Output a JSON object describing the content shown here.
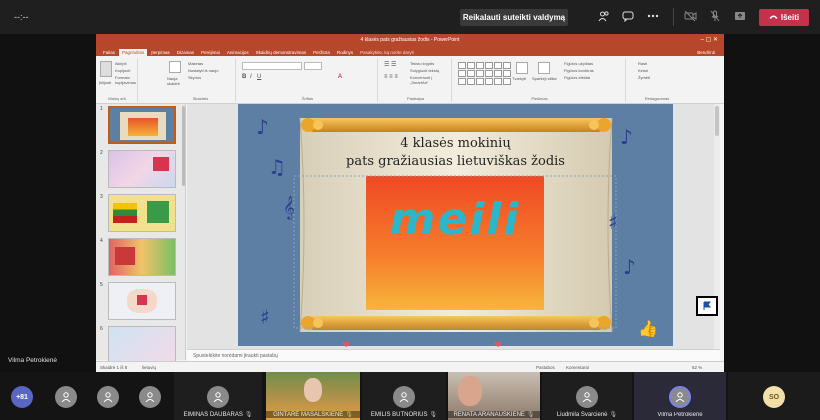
{
  "teams": {
    "timer": "--:--",
    "request_control_label": "Reikalauti suteikti valdymą",
    "leave_label": "Išeiti",
    "colors": {
      "leave": "#c4314b",
      "topbar": "#1f1f1f"
    }
  },
  "ppt": {
    "window_title": "4 klasės pats gražiausias žodis - PowerPoint",
    "tabs": [
      "Failas",
      "Pagrindinis",
      "Įterpimas",
      "Dizainas",
      "Perėjimai",
      "Animacijos",
      "Skaidrių demonstravimas",
      "Peržiūra",
      "Rodinys",
      "Pasakykite, ką norite daryti"
    ],
    "share_label": "Bendrinti",
    "ribbon": {
      "clipboard": {
        "label": "Mainų srit.",
        "items": [
          "Įklijuoti",
          "Iškirpti",
          "Kopijuoti",
          "Formato kopijavimas"
        ]
      },
      "slides": {
        "label": "Skaidrės",
        "new_slide": "Nauja skaidrė",
        "items": [
          "Maketas",
          "Nustatyti iš naujo",
          "Skyrius"
        ]
      },
      "font": {
        "label": "Šriftas"
      },
      "paragraph": {
        "label": "Pastraipa",
        "items": [
          "Teksto kryptis",
          "Sulygiuoti tekstą",
          "Konvertuoti į „SmartArt“"
        ]
      },
      "drawing": {
        "label": "Piešimas",
        "arrange": "Tvarkyti",
        "quick_styles": "Spartieji stiliai",
        "items": [
          "Figūros užpildas",
          "Figūros kontūras",
          "Figūros efektai"
        ]
      },
      "editing": {
        "label": "Redagavimas",
        "items": [
          "Rasti",
          "Keisti",
          "Žymėti"
        ]
      }
    },
    "slide": {
      "title_line1": "4 klasės mokinių",
      "title_line2": "pats gražiausias lietuviškas žodis",
      "word": "meili"
    },
    "thumbnails": [
      "1",
      "2",
      "3",
      "4",
      "5",
      "6"
    ],
    "notes_placeholder": "Spustelėkite norėdami įtraukti pastabų",
    "status": {
      "slide_counter": "Skaidrė 1 iš 8",
      "language": "lietuvių",
      "notes": "Pastabos",
      "comments": "Komentarai",
      "zoom": "62 %"
    }
  },
  "presenter": "Vilma Petrokienė",
  "participants": {
    "overflow": "+81",
    "named": [
      "EIMINAS DAUBARAS",
      "GINTARĖ MASALSKIENĖ",
      "EMILIS BUTNORIUS",
      "RENATA ARANAUSKIENĖ",
      "Liudmila Švarcienė",
      "Vilma Petrokienė"
    ],
    "initials": "SO"
  }
}
